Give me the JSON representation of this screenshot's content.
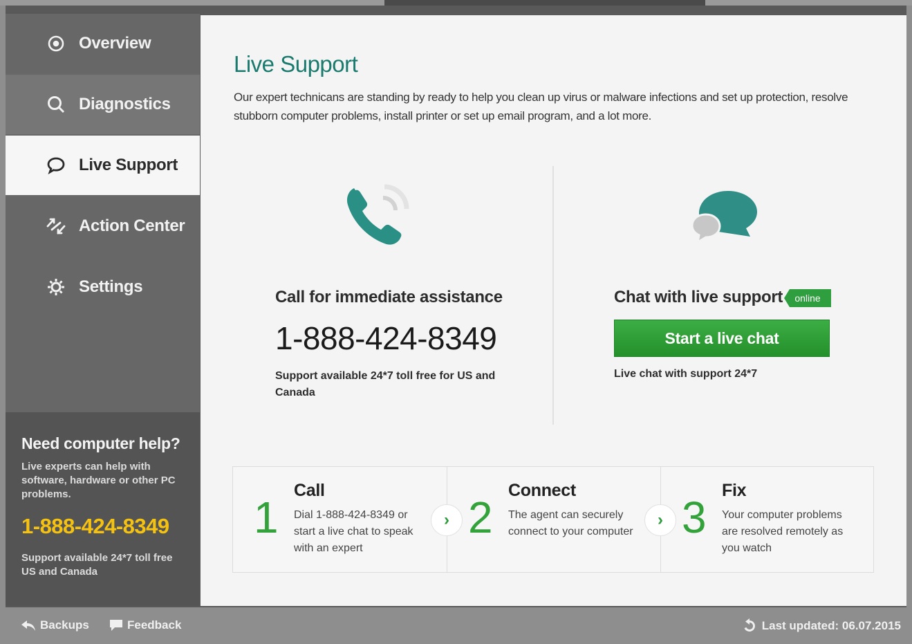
{
  "nav": {
    "overview": "Overview",
    "diagnostics": "Diagnostics",
    "live_support": "Live Support",
    "action_center": "Action Center",
    "settings": "Settings"
  },
  "promo": {
    "title": "Need computer help?",
    "description": "Live experts can help with software, hardware or other PC problems.",
    "phone": "1-888-424-8349",
    "availability": "Support available 24*7 toll free US and Canada"
  },
  "main": {
    "title": "Live Support",
    "intro": "Our expert technicans are standing by ready to help you clean up virus or malware infections and set up protection, resolve stubborn computer problems, install printer or set up email program, and a lot more.",
    "call": {
      "title": "Call for immediate assistance",
      "phone": "1-888-424-8349",
      "availability": "Support available 24*7 toll free for US and Canada"
    },
    "chat": {
      "title": "Chat with live support",
      "status_badge": "online",
      "button_label": "Start a live chat",
      "availability": "Live chat with support 24*7"
    },
    "steps": [
      {
        "number": "1",
        "title": "Call",
        "description": "Dial 1-888-424-8349 or start a live chat to speak with an expert"
      },
      {
        "number": "2",
        "title": "Connect",
        "description": "The agent can securely connect to your computer"
      },
      {
        "number": "3",
        "title": "Fix",
        "description": "Your computer problems are resolved remotely as you watch"
      }
    ]
  },
  "footer": {
    "backups": "Backups",
    "feedback": "Feedback",
    "last_updated": "Last updated: 06.07.2015"
  },
  "colors": {
    "accent_teal": "#1a7a6e",
    "green": "#2f9e3e",
    "phone_yellow": "#f5c211"
  }
}
